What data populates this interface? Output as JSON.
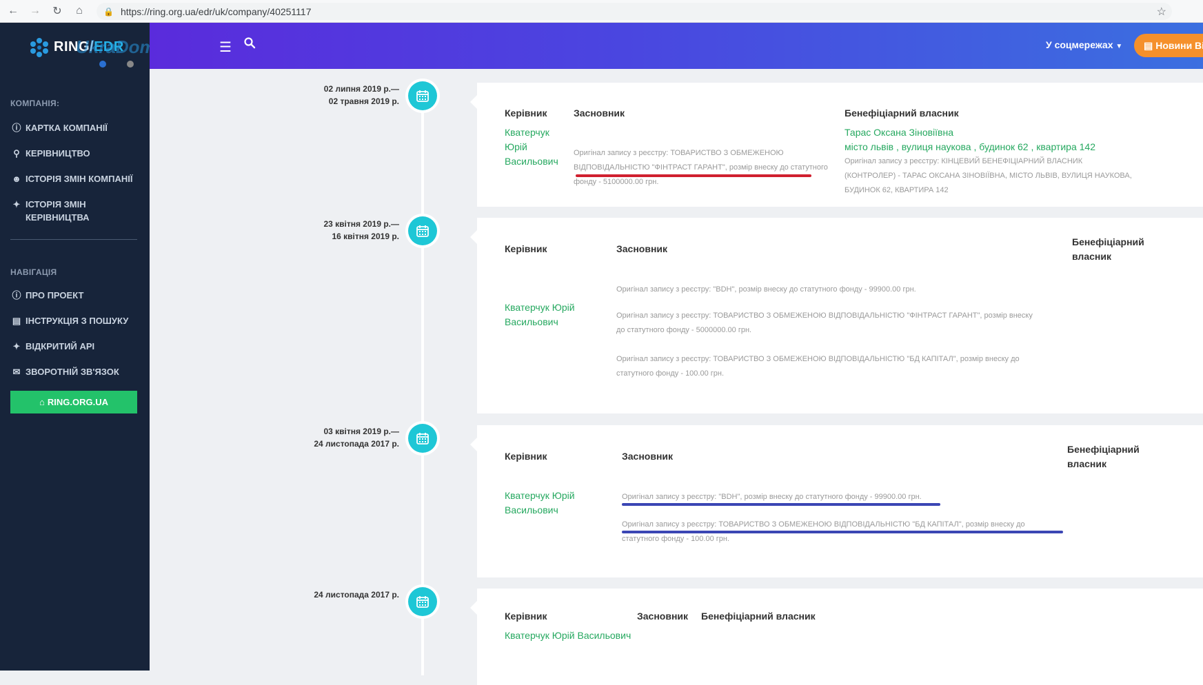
{
  "browser": {
    "url": "https://ring.org.ua/edr/uk/company/40251117"
  },
  "logo": {
    "ring": "RING",
    "sep": "/",
    "edr": "EDR",
    "watermark": "UkraDomik.ua"
  },
  "header": {
    "social": "У соцмережах",
    "news": "Новини Ві"
  },
  "sidebar": {
    "company_title": "КОМПАНІЯ:",
    "company_items": [
      "КАРТКА КОМПАНІЇ",
      "КЕРІВНИЦТВО",
      "ІСТОРІЯ ЗМІН КОМПАНІЇ",
      "ІСТОРІЯ ЗМІН КЕРІВНИЦТВА"
    ],
    "nav_title": "НАВІГАЦІЯ",
    "nav_items": [
      "ПРО ПРОЕКТ",
      "ІНСТРУКЦІЯ З ПОШУКУ",
      "ВІДКРИТИЙ API",
      "ЗВОРОТНІЙ ЗВ'ЯЗОК"
    ],
    "ring_button": "RING.ORG.UA"
  },
  "colors": {
    "accent_green": "#25a85f",
    "timeline_cyan": "#1ec7d6",
    "underline_red": "#d0202f",
    "underline_blue": "#3b46b4"
  },
  "columns": {
    "director": "Керівник",
    "founder": "Засновник",
    "beneficiary": "Бенефіціарний власник"
  },
  "entries": [
    {
      "date_from": "02 липня 2019 р.—",
      "date_to": "02 травня 2019 р.",
      "director": "Кватерчук Юрій Васильович",
      "founders": [
        "Оригінал запису з реєстру: ТОВАРИСТВО З ОБМЕЖЕНОЮ ВІДПОВІДАЛЬНІСТЮ \"ФІНТРАСТ ГАРАНТ\", розмір внеску до статутного фонду - 5100000.00 грн."
      ],
      "beneficiary_name": "Тарас Оксана Зіновіївна",
      "beneficiary_address": "місто львів , вулиця наукова , будинок 62 , квартира 142",
      "beneficiary_orig": "Оригінал запису з реєстру: КІНЦЕВИЙ БЕНЕФІЦІАРНИЙ ВЛАСНИК (КОНТРОЛЕР) - ТАРАС ОКСАНА ЗІНОВІЇВНА, МІСТО ЛЬВІВ, ВУЛИЦЯ НАУКОВА, БУДИНОК 62, КВАРТИРА 142"
    },
    {
      "date_from": "23 квітня 2019 р.—",
      "date_to": "16 квітня 2019 р.",
      "director": "Кватерчук Юрій Васильович",
      "founders": [
        "Оригінал запису з реєстру: \"ВDН\", розмір внеску до статутного фонду - 99900.00 грн.",
        "Оригінал запису з реєстру: ТОВАРИСТВО З ОБМЕЖЕНОЮ ВІДПОВІДАЛЬНІСТЮ \"ФІНТРАСТ ГАРАНТ\", розмір внеску до статутного фонду - 5000000.00 грн.",
        "Оригінал запису з реєстру: ТОВАРИСТВО З ОБМЕЖЕНОЮ ВІДПОВІДАЛЬНІСТЮ \"БД КАПІТАЛ\", розмір внеску до статутного фонду - 100.00 грн."
      ]
    },
    {
      "date_from": "03 квітня 2019 р.—",
      "date_to": "24 листопада 2017 р.",
      "director": "Кватерчук Юрій Васильович",
      "founders": [
        "Оригінал запису з реєстру: \"ВDН\", розмір внеску до статутного фонду - 99900.00 грн.",
        "Оригінал запису з реєстру: ТОВАРИСТВО З ОБМЕЖЕНОЮ ВІДПОВІДАЛЬНІСТЮ \"БД КАПІТАЛ\", розмір внеску до статутного фонду - 100.00 грн."
      ]
    },
    {
      "date_from": "24 листопада 2017 р.",
      "director": "Кватерчук Юрій Васильович"
    }
  ]
}
